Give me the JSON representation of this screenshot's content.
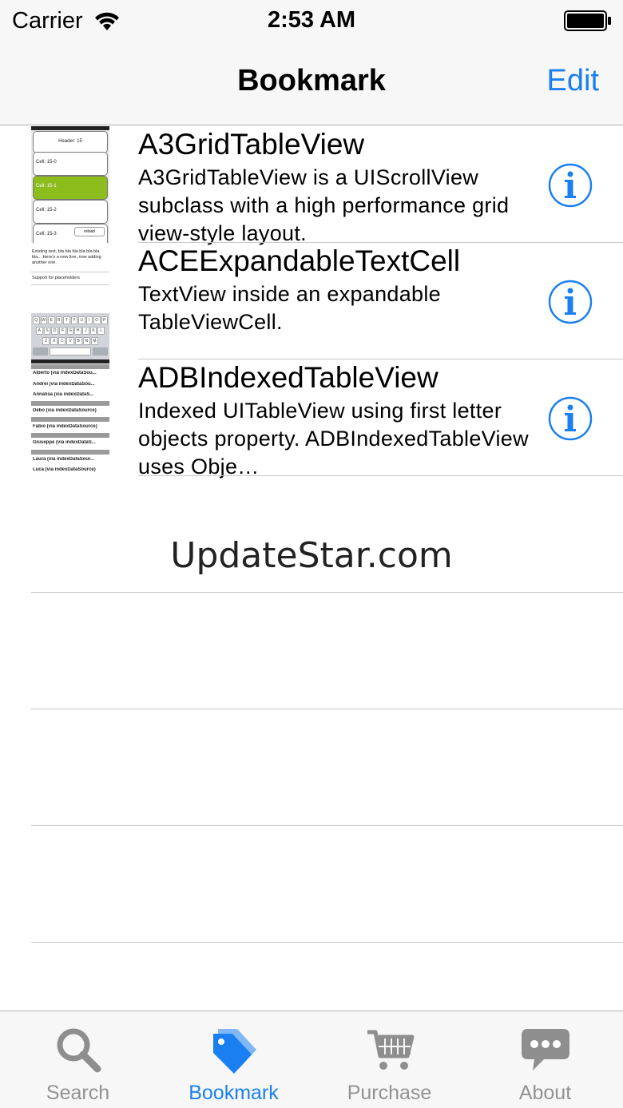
{
  "status_bar": {
    "carrier": "Carrier",
    "time": "2:53 AM"
  },
  "nav": {
    "title": "Bookmark",
    "edit_label": "Edit"
  },
  "rows": [
    {
      "title": "A3GridTableView",
      "description": "A3GridTableView is a UIScrollView subclass with a high performance grid view-style layout.",
      "thumb": {
        "header": "Header: 15",
        "cells": [
          "Cell: 15-0",
          "Cell: 15-1",
          "Cell: 15-2",
          "Cell: 15-3"
        ],
        "reload": "reload"
      }
    },
    {
      "title": "ACEExpandableTextCell",
      "description": "TextView inside an expandable TableViewCell.",
      "thumb": {
        "text": "Existing text, bla bla bla bla bla bla bla... Here's a new line, now adding another one.",
        "placeholder": "Support for placeholders",
        "keys_row1": [
          "Q",
          "W",
          "E",
          "R",
          "T",
          "Y",
          "U",
          "I",
          "O",
          "P"
        ],
        "keys_row2": [
          "A",
          "S",
          "D",
          "F",
          "G",
          "H",
          "J",
          "K",
          "L"
        ],
        "keys_row3": [
          "Z",
          "X",
          "C",
          "V",
          "B",
          "N",
          "M"
        ]
      }
    },
    {
      "title": "ADBIndexedTableView",
      "description": "Indexed UITableView using first letter objects property. ADBIndexedTableView uses Obje…",
      "thumb": {
        "items": [
          "Alberto (via indexDataSou...",
          "Andrei (via indexDataSou...",
          "Annalisa (via indexDataS...",
          "Debo (via indexDataSource)",
          "Fabio (via indexDataSource)",
          "Giuseppe (via indexDataS...",
          "Laura (via indexDataSour...",
          "Luca (via indexDataSource)"
        ]
      }
    }
  ],
  "watermark": "UpdateStar.com",
  "tabs": [
    {
      "label": "Search",
      "icon": "search-icon"
    },
    {
      "label": "Bookmark",
      "icon": "bookmark-tag-icon"
    },
    {
      "label": "Purchase",
      "icon": "cart-icon"
    },
    {
      "label": "About",
      "icon": "chat-bubble-icon"
    }
  ],
  "colors": {
    "accent": "#1a7ff0",
    "inactive_tab": "#929292",
    "bar_background": "#f7f7f7",
    "separator": "#c8c7cc",
    "thumb_green": "#8cbd1c"
  }
}
